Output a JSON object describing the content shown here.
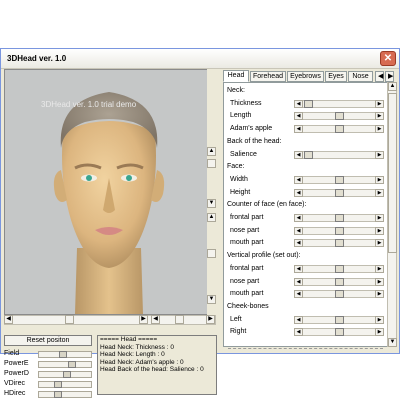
{
  "window": {
    "title": "3DHead ver. 1.0",
    "close_label": "✕"
  },
  "viewport": {
    "overlay_text": "3DHead ver. 1.0    trial demo"
  },
  "left_controls": {
    "reset_label": "Reset positon",
    "params": [
      {
        "label": "Field",
        "value": 0.45
      },
      {
        "label": "PowerE",
        "value": 0.65
      },
      {
        "label": "PowerD",
        "value": 0.55
      },
      {
        "label": "VDirec",
        "value": 0.35
      },
      {
        "label": "HDirec",
        "value": 0.35
      }
    ]
  },
  "log": {
    "lines": [
      "=====      Head      =====",
      "Head Neck: Thickness : 0",
      "Head Neck: Length : 0",
      "Head Neck: Adam's apple : 0",
      "Head Back of the head: Salience : 0"
    ]
  },
  "tabs": [
    {
      "label": "Head",
      "active": true
    },
    {
      "label": "Forehead",
      "active": false
    },
    {
      "label": "Eyebrows",
      "active": false
    },
    {
      "label": "Eyes",
      "active": false
    },
    {
      "label": "Nose",
      "active": false
    }
  ],
  "panel": {
    "rows": [
      {
        "kind": "section",
        "label": "Neck:"
      },
      {
        "kind": "slider",
        "label": "Thickness",
        "value": 0.0
      },
      {
        "kind": "slider",
        "label": "Length",
        "value": 0.5
      },
      {
        "kind": "slider",
        "label": "Adam's apple",
        "value": 0.5
      },
      {
        "kind": "section",
        "label": "Back of the head:"
      },
      {
        "kind": "slider",
        "label": "Salience",
        "value": 0.0
      },
      {
        "kind": "section",
        "label": "Face:"
      },
      {
        "kind": "slider",
        "label": "Width",
        "value": 0.5
      },
      {
        "kind": "slider",
        "label": "Height",
        "value": 0.5
      },
      {
        "kind": "section",
        "label": "Counter of face (en face):"
      },
      {
        "kind": "slider",
        "label": "frontal part",
        "value": 0.5
      },
      {
        "kind": "slider",
        "label": "nose part",
        "value": 0.5
      },
      {
        "kind": "slider",
        "label": "mouth part",
        "value": 0.5
      },
      {
        "kind": "section",
        "label": "Vertical profile (set out):"
      },
      {
        "kind": "slider",
        "label": "frontal part",
        "value": 0.5
      },
      {
        "kind": "slider",
        "label": "nose part",
        "value": 0.5
      },
      {
        "kind": "slider",
        "label": "mouth part",
        "value": 0.5
      },
      {
        "kind": "section",
        "label": "Cheek-bones"
      },
      {
        "kind": "slider",
        "label": "Left",
        "value": 0.5
      },
      {
        "kind": "slider",
        "label": "Right",
        "value": 0.5
      }
    ]
  },
  "colors": {
    "window_bg": "#ece9d8",
    "viewport_bg": "#c5c7c7",
    "skin": "#e2c089",
    "hair": "#9a8e7e",
    "eyes": "#3aa590",
    "lips": "#d58a84"
  }
}
